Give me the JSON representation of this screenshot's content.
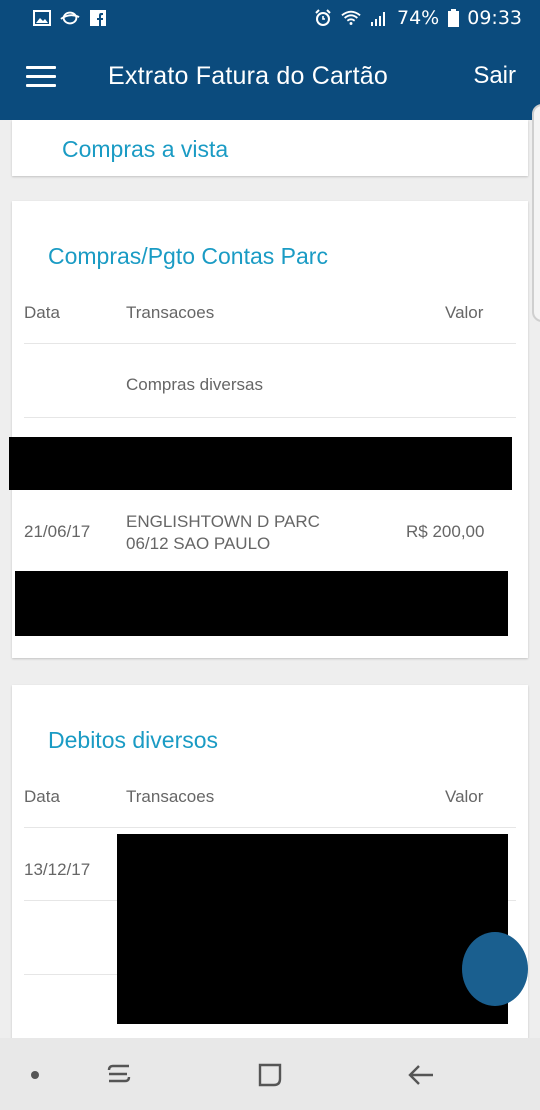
{
  "status_bar": {
    "battery_text": "74%",
    "time": "09:33",
    "left_icons": [
      "gallery-icon",
      "sync-icon",
      "facebook-icon"
    ],
    "right_icons": [
      "alarm-icon",
      "wifi-icon",
      "signal-icon",
      "battery-icon"
    ]
  },
  "app_bar": {
    "title": "Extrato Fatura do Cartão",
    "logout_label": "Sair"
  },
  "sections": {
    "compras_vista": {
      "title": "Compras a vista"
    },
    "compras_parc": {
      "title": "Compras/Pgto Contas Parc",
      "headers": {
        "date": "Data",
        "transactions": "Transacoes",
        "value": "Valor"
      },
      "rows": [
        {
          "date": "",
          "transaction_line1": "Compras diversas",
          "transaction_line2": "",
          "value": ""
        },
        {
          "date": "21/06/17",
          "transaction_line1": "ENGLISHTOWN D PARC",
          "transaction_line2": "06/12 SAO PAULO",
          "value": "R$ 200,00"
        }
      ]
    },
    "debitos": {
      "title": "Debitos diversos",
      "headers": {
        "date": "Data",
        "transactions": "Transacoes",
        "value": "Valor"
      },
      "rows": [
        {
          "date": "13/12/17"
        }
      ]
    }
  },
  "colors": {
    "primary": "#0b4b7d",
    "accent_text": "#1a9bc4",
    "background": "#eeeeee",
    "redaction": "#000000"
  },
  "nav_bar": {
    "icons": [
      "dot-icon",
      "recent-apps-icon",
      "home-icon",
      "back-icon"
    ]
  }
}
